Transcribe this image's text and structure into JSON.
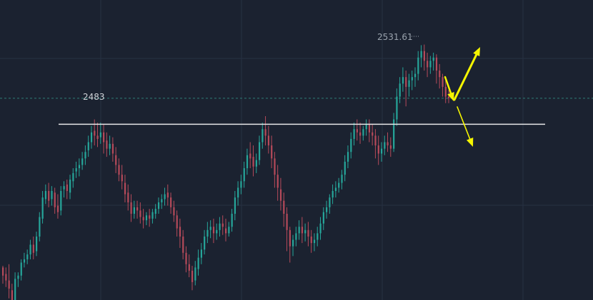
{
  "chart_data": {
    "type": "candlestick",
    "y_axis": "price",
    "ylim": [
      2375,
      2555
    ],
    "grid": true,
    "colors": {
      "background": "#1b2230",
      "grid": "#273142",
      "up": "#26a69a",
      "down": "#b54a5a",
      "level_line": "#e8e8e8",
      "current_price_line": "#2f7d77",
      "arrows": "#f5f500",
      "label_text": "#d0d3d8",
      "high_label_text": "#9aa3ad"
    },
    "annotations": {
      "level_value": 2483,
      "level_label": "2483",
      "high_value": 2531.61,
      "high_label": "2531.61",
      "current_price": 2499
    },
    "candles": [
      [
        2395,
        2396,
        2390,
        2385
      ],
      [
        2391,
        2395,
        2387,
        2383
      ],
      [
        2387,
        2397,
        2382,
        2376
      ],
      [
        2381,
        2385,
        2375,
        2370
      ],
      [
        2375,
        2392,
        2388,
        2372
      ],
      [
        2388,
        2392,
        2390,
        2383
      ],
      [
        2390,
        2400,
        2398,
        2387
      ],
      [
        2398,
        2404,
        2400,
        2395
      ],
      [
        2400,
        2406,
        2403,
        2397
      ],
      [
        2403,
        2412,
        2409,
        2400
      ],
      [
        2409,
        2414,
        2404,
        2400
      ],
      [
        2405,
        2417,
        2414,
        2402
      ],
      [
        2414,
        2429,
        2426,
        2411
      ],
      [
        2425,
        2442,
        2438,
        2422
      ],
      [
        2437,
        2446,
        2442,
        2434
      ],
      [
        2442,
        2447,
        2436,
        2432
      ],
      [
        2437,
        2445,
        2442,
        2433
      ],
      [
        2441,
        2444,
        2432,
        2428
      ],
      [
        2433,
        2440,
        2429,
        2425
      ],
      [
        2430,
        2445,
        2442,
        2427
      ],
      [
        2443,
        2448,
        2445,
        2438
      ],
      [
        2446,
        2449,
        2442,
        2437
      ],
      [
        2441,
        2452,
        2449,
        2437
      ],
      [
        2448,
        2456,
        2453,
        2444
      ],
      [
        2454,
        2460,
        2456,
        2450
      ],
      [
        2456,
        2462,
        2458,
        2451
      ],
      [
        2458,
        2466,
        2462,
        2455
      ],
      [
        2462,
        2470,
        2466,
        2458
      ],
      [
        2467,
        2476,
        2472,
        2463
      ],
      [
        2472,
        2482,
        2478,
        2468
      ],
      [
        2479,
        2486,
        2476,
        2470
      ],
      [
        2476,
        2484,
        2474,
        2469
      ],
      [
        2475,
        2484,
        2478,
        2471
      ],
      [
        2478,
        2483,
        2472,
        2465
      ],
      [
        2473,
        2478,
        2468,
        2463
      ],
      [
        2468,
        2476,
        2471,
        2464
      ],
      [
        2471,
        2475,
        2465,
        2460
      ],
      [
        2464,
        2469,
        2458,
        2453
      ],
      [
        2458,
        2462,
        2452,
        2448
      ],
      [
        2452,
        2458,
        2448,
        2443
      ],
      [
        2447,
        2452,
        2440,
        2435
      ],
      [
        2441,
        2446,
        2435,
        2430
      ],
      [
        2435,
        2440,
        2428,
        2423
      ],
      [
        2428,
        2436,
        2432,
        2425
      ],
      [
        2432,
        2436,
        2430,
        2425
      ],
      [
        2430,
        2435,
        2426,
        2422
      ],
      [
        2426,
        2431,
        2424,
        2419
      ],
      [
        2424,
        2429,
        2427,
        2421
      ],
      [
        2427,
        2431,
        2425,
        2420
      ],
      [
        2425,
        2431,
        2429,
        2422
      ],
      [
        2428,
        2434,
        2431,
        2425
      ],
      [
        2431,
        2438,
        2435,
        2428
      ],
      [
        2435,
        2440,
        2437,
        2431
      ],
      [
        2437,
        2444,
        2440,
        2433
      ],
      [
        2441,
        2446,
        2438,
        2433
      ],
      [
        2438,
        2441,
        2432,
        2428
      ],
      [
        2432,
        2436,
        2427,
        2423
      ],
      [
        2427,
        2430,
        2419,
        2414
      ],
      [
        2420,
        2425,
        2414,
        2407
      ],
      [
        2414,
        2418,
        2404,
        2400
      ],
      [
        2404,
        2408,
        2397,
        2392
      ],
      [
        2397,
        2403,
        2393,
        2389
      ],
      [
        2393,
        2396,
        2386,
        2381
      ],
      [
        2387,
        2399,
        2395,
        2384
      ],
      [
        2394,
        2406,
        2401,
        2390
      ],
      [
        2401,
        2410,
        2406,
        2397
      ],
      [
        2406,
        2418,
        2414,
        2403
      ],
      [
        2414,
        2423,
        2418,
        2410
      ],
      [
        2418,
        2424,
        2420,
        2413
      ],
      [
        2420,
        2425,
        2416,
        2410
      ],
      [
        2416,
        2422,
        2418,
        2412
      ],
      [
        2418,
        2426,
        2422,
        2414
      ],
      [
        2422,
        2427,
        2420,
        2415
      ],
      [
        2419,
        2425,
        2416,
        2411
      ],
      [
        2416,
        2423,
        2420,
        2414
      ],
      [
        2420,
        2431,
        2428,
        2417
      ],
      [
        2428,
        2442,
        2438,
        2424
      ],
      [
        2438,
        2448,
        2444,
        2433
      ],
      [
        2444,
        2452,
        2448,
        2440
      ],
      [
        2448,
        2460,
        2456,
        2444
      ],
      [
        2456,
        2468,
        2464,
        2452
      ],
      [
        2465,
        2472,
        2462,
        2456
      ],
      [
        2463,
        2470,
        2457,
        2451
      ],
      [
        2457,
        2465,
        2461,
        2453
      ],
      [
        2461,
        2476,
        2472,
        2458
      ],
      [
        2472,
        2484,
        2480,
        2468
      ],
      [
        2480,
        2488,
        2476,
        2470
      ],
      [
        2476,
        2482,
        2470,
        2465
      ],
      [
        2470,
        2476,
        2462,
        2456
      ],
      [
        2462,
        2466,
        2452,
        2444
      ],
      [
        2452,
        2458,
        2444,
        2436
      ],
      [
        2443,
        2450,
        2436,
        2430
      ],
      [
        2436,
        2441,
        2428,
        2420
      ],
      [
        2428,
        2432,
        2418,
        2405
      ],
      [
        2418,
        2420,
        2408,
        2398
      ],
      [
        2408,
        2415,
        2412,
        2402
      ],
      [
        2412,
        2420,
        2416,
        2408
      ],
      [
        2416,
        2424,
        2420,
        2412
      ],
      [
        2420,
        2426,
        2416,
        2410
      ],
      [
        2416,
        2422,
        2418,
        2411
      ],
      [
        2418,
        2423,
        2414,
        2408
      ],
      [
        2414,
        2418,
        2410,
        2404
      ],
      [
        2410,
        2416,
        2412,
        2405
      ],
      [
        2412,
        2420,
        2416,
        2408
      ],
      [
        2416,
        2426,
        2422,
        2412
      ],
      [
        2422,
        2432,
        2429,
        2418
      ],
      [
        2429,
        2436,
        2432,
        2425
      ],
      [
        2432,
        2440,
        2438,
        2428
      ],
      [
        2438,
        2446,
        2442,
        2434
      ],
      [
        2442,
        2448,
        2444,
        2438
      ],
      [
        2444,
        2450,
        2447,
        2441
      ],
      [
        2447,
        2455,
        2452,
        2443
      ],
      [
        2452,
        2464,
        2460,
        2448
      ],
      [
        2460,
        2470,
        2466,
        2456
      ],
      [
        2466,
        2478,
        2474,
        2462
      ],
      [
        2474,
        2484,
        2480,
        2470
      ],
      [
        2480,
        2486,
        2478,
        2473
      ],
      [
        2478,
        2484,
        2476,
        2471
      ],
      [
        2476,
        2482,
        2480,
        2473
      ],
      [
        2480,
        2486,
        2483,
        2476
      ],
      [
        2483,
        2486,
        2478,
        2472
      ],
      [
        2478,
        2483,
        2476,
        2470
      ],
      [
        2476,
        2480,
        2470,
        2462
      ],
      [
        2470,
        2476,
        2465,
        2458
      ],
      [
        2465,
        2472,
        2468,
        2460
      ],
      [
        2468,
        2476,
        2472,
        2464
      ],
      [
        2472,
        2478,
        2470,
        2466
      ],
      [
        2470,
        2475,
        2468,
        2463
      ],
      [
        2468,
        2490,
        2486,
        2466
      ],
      [
        2486,
        2505,
        2500,
        2482
      ],
      [
        2500,
        2512,
        2508,
        2496
      ],
      [
        2508,
        2518,
        2512,
        2503
      ],
      [
        2512,
        2516,
        2506,
        2494
      ],
      [
        2506,
        2514,
        2510,
        2500
      ],
      [
        2510,
        2516,
        2512,
        2504
      ],
      [
        2512,
        2518,
        2514,
        2506
      ],
      [
        2514,
        2528,
        2524,
        2510
      ],
      [
        2524,
        2531.61,
        2528,
        2518
      ],
      [
        2528,
        2532,
        2522,
        2516
      ],
      [
        2522,
        2527,
        2518,
        2512
      ],
      [
        2518,
        2525,
        2522,
        2514
      ],
      [
        2522,
        2527,
        2524,
        2516
      ],
      [
        2524,
        2526,
        2516,
        2508
      ],
      [
        2516,
        2520,
        2512,
        2505
      ],
      [
        2512,
        2514,
        2506,
        2500
      ],
      [
        2506,
        2510,
        2500,
        2496
      ],
      [
        2500,
        2504,
        2499,
        2496
      ]
    ]
  }
}
